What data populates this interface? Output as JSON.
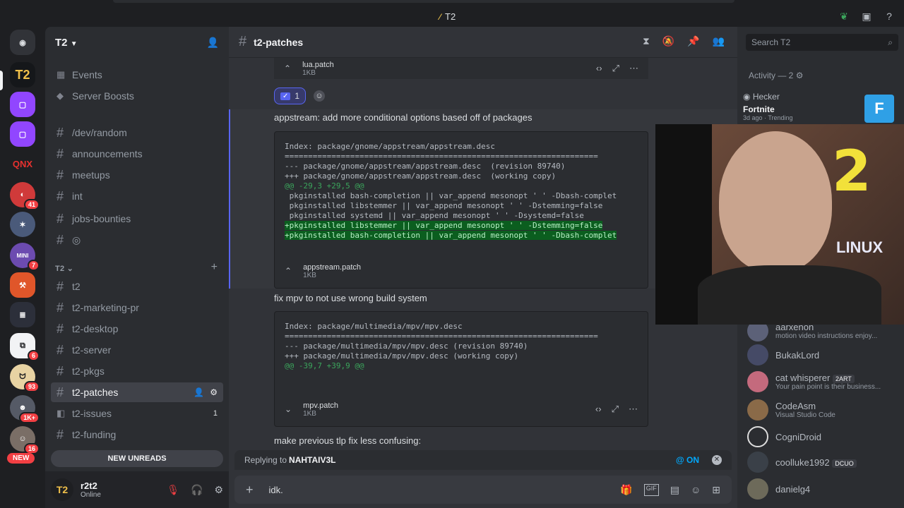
{
  "window": {
    "title": "T2"
  },
  "server_rail": {
    "badges": [
      "41",
      "7",
      "6",
      "93",
      "1K+",
      "16"
    ],
    "qnx_label": "QNX",
    "new_label": "NEW"
  },
  "guild": {
    "name": "T2"
  },
  "sidebar": {
    "top_items": [
      {
        "label": "Events",
        "icon": "calendar-icon"
      },
      {
        "label": "Server Boosts",
        "icon": "boost-icon"
      }
    ],
    "channels": [
      {
        "label": "/dev/random"
      },
      {
        "label": "announcements"
      },
      {
        "label": "meetups"
      },
      {
        "label": "int"
      },
      {
        "label": "jobs-bounties"
      },
      {
        "label": "◎"
      }
    ],
    "category": "T2",
    "t2_channels": [
      {
        "label": "t2"
      },
      {
        "label": "t2-marketing-pr"
      },
      {
        "label": "t2-desktop"
      },
      {
        "label": "t2-server"
      },
      {
        "label": "t2-pkgs"
      },
      {
        "label": "t2-patches",
        "active": true
      },
      {
        "label": "t2-issues",
        "count": "1"
      },
      {
        "label": "t2-funding"
      }
    ],
    "new_unreads": "NEW UNREADS"
  },
  "user": {
    "name": "r2t2",
    "status": "Online"
  },
  "channel": {
    "name": "t2-patches"
  },
  "messages": {
    "top_attachment": {
      "name": "lua.patch",
      "size": "1KB"
    },
    "reaction_count": "1",
    "msg1_text": "appstream: add more conditional options based off of packages",
    "msg1_code": [
      {
        "t": "Index: package/gnome/appstream/appstream.desc",
        "c": ""
      },
      {
        "t": "===================================================================",
        "c": ""
      },
      {
        "t": "--- package/gnome/appstream/appstream.desc  (revision 89740)",
        "c": ""
      },
      {
        "t": "+++ package/gnome/appstream/appstream.desc  (working copy)",
        "c": ""
      },
      {
        "t": "@@ -29,3 +29,5 @@",
        "c": "hunk"
      },
      {
        "t": " pkginstalled bash-completion || var_append mesonopt ' ' -Dbash-complet",
        "c": ""
      },
      {
        "t": " pkginstalled libstemmer || var_append mesonopt ' ' -Dstemming=false",
        "c": ""
      },
      {
        "t": " pkginstalled systemd || var_append mesonopt ' ' -Dsystemd=false",
        "c": ""
      },
      {
        "t": "+pkginstalled libstemmer || var_append mesonopt ' ' -Dstemming=false",
        "c": "addbg"
      },
      {
        "t": "+pkginstalled bash-completion || var_append mesonopt ' ' -Dbash-complet",
        "c": "addbg"
      }
    ],
    "msg1_attachment": {
      "name": "appstream.patch",
      "size": "1KB"
    },
    "msg2_text": "fix mpv  to not use wrong build system",
    "msg2_code": [
      {
        "t": "Index: package/multimedia/mpv/mpv.desc",
        "c": ""
      },
      {
        "t": "===================================================================",
        "c": ""
      },
      {
        "t": "--- package/multimedia/mpv/mpv.desc (revision 89740)",
        "c": ""
      },
      {
        "t": "+++ package/multimedia/mpv/mpv.desc (working copy)",
        "c": ""
      },
      {
        "t": "@@ -39,7 +39,9 @@",
        "c": "hunk"
      }
    ],
    "msg2_attachment": {
      "name": "mpv.patch",
      "size": "1KB"
    },
    "msg3_text": "make previous tlp fix less confusing:"
  },
  "composer": {
    "reply_prefix": "Replying to ",
    "reply_to": "NAHTAIV3L",
    "mention_toggle": "ON",
    "input_value": "idk."
  },
  "search": {
    "placeholder": "Search T2"
  },
  "activity": {
    "header": "Activity — 2",
    "user": "Hecker",
    "game": "Fortnite",
    "meta": "3d ago",
    "trend": "Trending"
  },
  "members": [
    {
      "name": "aarxenon",
      "sub": "motion video instructions enjoy..."
    },
    {
      "name": "BukakLord",
      "sub": ""
    },
    {
      "name": "cat whisperer",
      "tag": "2ART",
      "sub": "Your pain point is their business..."
    },
    {
      "name": "CodeAsm",
      "sub": "Visual Studio Code"
    },
    {
      "name": "CogniDroid",
      "sub": ""
    },
    {
      "name": "coolluke1992",
      "tag": "DCUO",
      "sub": ""
    },
    {
      "name": "danielg4",
      "sub": ""
    }
  ],
  "webcam": {
    "sign": "LINUX"
  },
  "colors": {
    "accent": "#5865f2",
    "online": "#23a55a",
    "badge": "#f23f43"
  }
}
